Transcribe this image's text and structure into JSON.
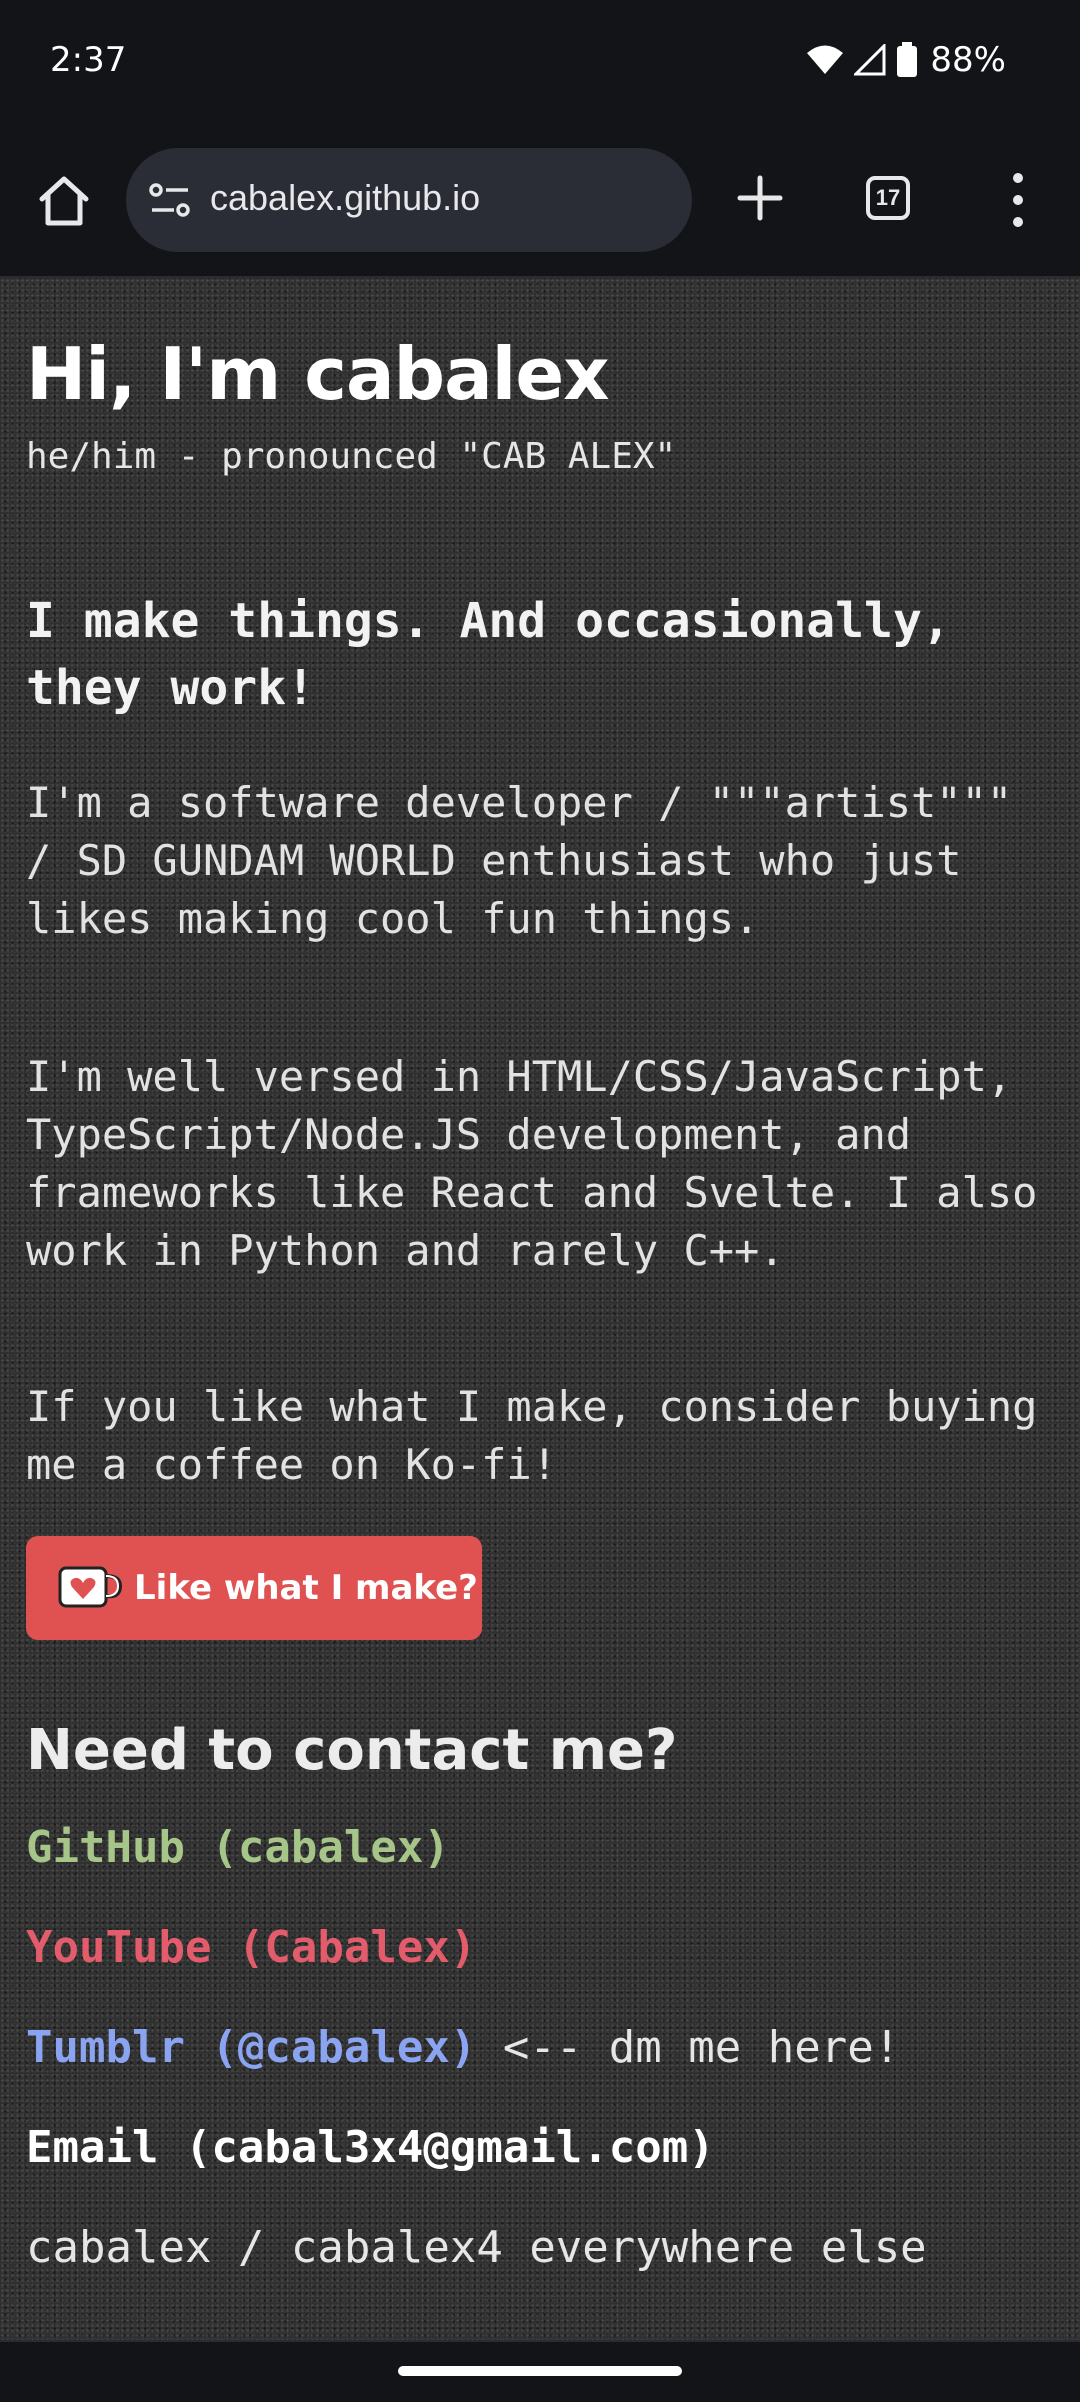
{
  "status_bar": {
    "time": "2:37",
    "battery": "88%",
    "icons": [
      "wifi-icon",
      "signal-icon",
      "battery-icon"
    ]
  },
  "browser": {
    "url": "cabalex.github.io",
    "tab_count": "17",
    "icons": [
      "home-icon",
      "site-settings-icon",
      "plus-icon",
      "tabs-icon",
      "more-vert-icon"
    ]
  },
  "page": {
    "title": "Hi, I'm cabalex",
    "subtitle": "he/him - pronounced \"CAB ALEX\"",
    "tagline": "I make things. And occasionally, they work!",
    "paragraphs": [
      "I'm a software developer / \"\"\"artist\"\"\" / SD GUNDAM WORLD enthusiast who just likes making cool fun things.",
      "I'm well versed in HTML/CSS/JavaScript, TypeScript/Node.JS development, and frameworks like React and Svelte. I also work in Python and rarely C++.",
      "If you like what I make, consider buying me a coffee on Ko-fi!"
    ],
    "kofi_button": "Like what I make?",
    "contact_heading": "Need to contact me?",
    "contacts": {
      "github": "GitHub (cabalex)",
      "youtube": "YouTube (Cabalex)",
      "tumblr": "Tumblr (@cabalex)",
      "tumblr_note": " <-- dm me here!",
      "email": "Email (cabal3x4@gmail.com)",
      "elsewhere": "cabalex / cabalex4 everywhere else"
    }
  },
  "colors": {
    "github": "#a6c588",
    "youtube": "#e25c6c",
    "tumblr": "#8aa4f2",
    "kofi": "#e05252"
  }
}
